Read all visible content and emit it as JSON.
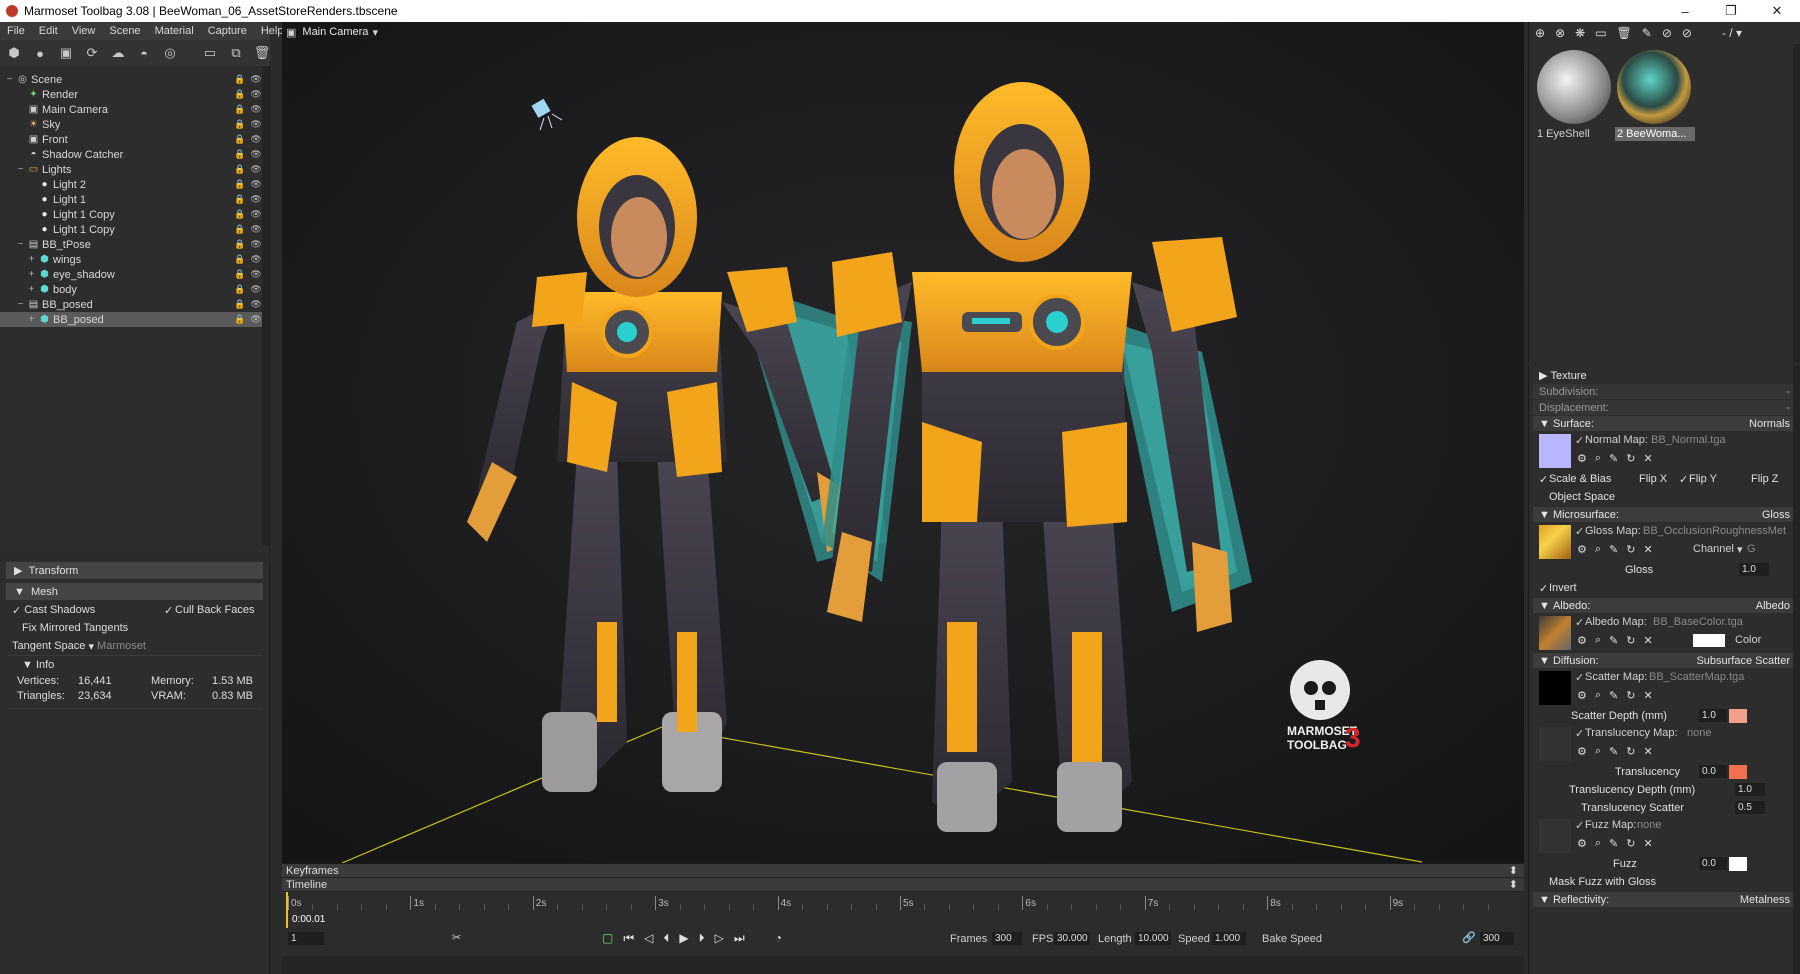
{
  "titlebar": {
    "title": "Marmoset Toolbag 3.08  |  BeeWoman_06_AssetStoreRenders.tbscene",
    "minimize": "–",
    "restore": "❐",
    "close": "✕"
  },
  "menu": [
    "File",
    "Edit",
    "View",
    "Scene",
    "Material",
    "Capture",
    "Help"
  ],
  "viewport": {
    "camera": "Main Camera",
    "watermark_line1": "MARMOSET",
    "watermark_line2": "TOOLBAG",
    "watermark_num": "3"
  },
  "scene_tree": [
    {
      "label": "Scene",
      "icon": "scene-icon",
      "indent": 0,
      "expand": "−"
    },
    {
      "label": "Render",
      "icon": "render-icon",
      "indent": 1
    },
    {
      "label": "Main Camera",
      "icon": "camera-icon",
      "indent": 1
    },
    {
      "label": "Sky",
      "icon": "sky-icon",
      "indent": 1
    },
    {
      "label": "Front",
      "icon": "camera-icon",
      "indent": 1
    },
    {
      "label": "Shadow Catcher",
      "icon": "shadow-catcher-icon",
      "indent": 1
    },
    {
      "label": "Lights",
      "icon": "folder-icon",
      "indent": 1,
      "expand": "−"
    },
    {
      "label": "Light 2",
      "icon": "light-icon",
      "indent": 2
    },
    {
      "label": "Light 1",
      "icon": "light-icon",
      "indent": 2
    },
    {
      "label": "Light 1 Copy",
      "icon": "light-icon",
      "indent": 2
    },
    {
      "label": "Light 1 Copy",
      "icon": "light-icon",
      "indent": 2
    },
    {
      "label": "BB_tPose",
      "icon": "model-icon",
      "indent": 1,
      "expand": "−"
    },
    {
      "label": "wings",
      "icon": "mesh-icon",
      "indent": 2,
      "expand": "+"
    },
    {
      "label": "eye_shadow",
      "icon": "mesh-icon",
      "indent": 2,
      "expand": "+"
    },
    {
      "label": "body",
      "icon": "mesh-icon",
      "indent": 2,
      "expand": "+"
    },
    {
      "label": "BB_posed",
      "icon": "model-icon",
      "indent": 1,
      "expand": "−"
    },
    {
      "label": "BB_posed",
      "icon": "mesh-icon",
      "indent": 2,
      "expand": "+",
      "selected": true
    }
  ],
  "left_props": {
    "transform": "Transform",
    "mesh": "Mesh",
    "cast_shadows": "Cast Shadows",
    "cull_back_faces": "Cull Back Faces",
    "fix_mirrored": "Fix Mirrored Tangents",
    "tangent_space_label": "Tangent Space",
    "tangent_space_value": "Marmoset",
    "info": "Info",
    "vertices_label": "Vertices:",
    "vertices_value": "16,441",
    "triangles_label": "Triangles:",
    "triangles_value": "23,634",
    "memory_label": "Memory:",
    "memory_value": "1.53 MB",
    "vram_label": "VRAM:",
    "vram_value": "0.83 MB"
  },
  "materials": [
    {
      "label": "1 EyeShell"
    },
    {
      "label": "2 BeeWoma..."
    }
  ],
  "material_editor": {
    "texture": "Texture",
    "subdivision": "Subdivision:",
    "displacement": "Displacement:",
    "dash": "-",
    "surface": "Surface:",
    "surface_value": "Normals",
    "normal_map_label": "Normal Map:",
    "normal_map_file": "BB_Normal.tga",
    "scale_bias": "Scale & Bias",
    "flip_x": "Flip X",
    "flip_y": "Flip Y",
    "flip_z": "Flip Z",
    "object_space": "Object Space",
    "microsurface": "Microsurface:",
    "microsurface_value": "Gloss",
    "gloss_map_label": "Gloss Map:",
    "gloss_map_file": "BB_OcclusionRoughnessMet",
    "channel": "Channel",
    "channel_value": "G",
    "gloss": "Gloss",
    "gloss_value": "1.0",
    "invert": "Invert",
    "albedo": "Albedo:",
    "albedo_value": "Albedo",
    "albedo_map_label": "Albedo Map:",
    "albedo_map_file": "BB_BaseColor.tga",
    "color": "Color",
    "diffusion": "Diffusion:",
    "diffusion_value": "Subsurface Scatter",
    "scatter_map_label": "Scatter Map:",
    "scatter_map_file": "BB_ScatterMap.tga",
    "scatter_depth": "Scatter Depth (mm)",
    "scatter_depth_value": "1.0",
    "translucency_map_label": "Translucency Map:",
    "translucency_map_file": "none",
    "translucency": "Translucency",
    "translucency_value": "0.0",
    "translucency_depth": "Translucency Depth (mm)",
    "translucency_depth_value": "1.0",
    "translucency_scatter": "Translucency Scatter",
    "translucency_scatter_value": "0.5",
    "fuzz_map_label": "Fuzz Map:",
    "fuzz_map_file": "none",
    "fuzz": "Fuzz",
    "fuzz_value": "0.0",
    "mask_fuzz": "Mask Fuzz with Gloss",
    "reflectivity": "Reflectivity:",
    "reflectivity_value": "Metalness"
  },
  "timeline": {
    "keyframes": "Keyframes",
    "timeline": "Timeline",
    "current_time": "0:00.01",
    "ticks": [
      "0s",
      "1s",
      "2s",
      "3s",
      "4s",
      "5s",
      "6s",
      "7s",
      "8s",
      "9s"
    ],
    "frame_field": "1",
    "frames_label": "Frames",
    "frames_value": "300",
    "fps_label": "FPS",
    "fps_value": "30.000",
    "length_label": "Length",
    "length_value": "10.000",
    "speed_label": "Speed",
    "speed_value": "1.000",
    "bake_speed": "Bake Speed",
    "end_frame": "300"
  },
  "colors": {
    "accent_yellow": "#f2a41b",
    "wing_cyan": "#4fd6d0",
    "suit_dark": "#3a3640",
    "normal_swatch": "#b7b6ff",
    "scatter_swatch": "#f2a08a",
    "trans_swatch": "#f07050"
  }
}
